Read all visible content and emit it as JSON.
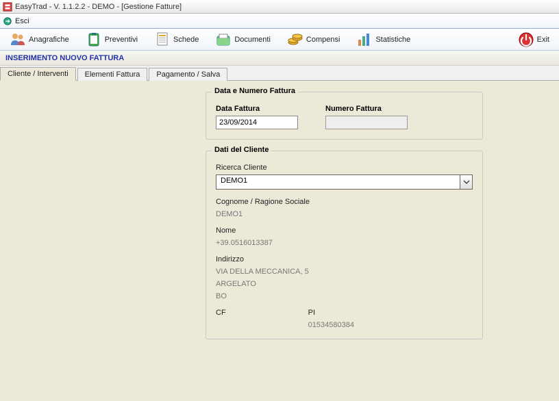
{
  "window": {
    "title": "EasyTrad - V. 1.1.2.2 - DEMO - [Gestione Fatture]"
  },
  "menu": {
    "esci": "Esci"
  },
  "toolbar": {
    "items": [
      {
        "label": "Anagrafiche"
      },
      {
        "label": "Preventivi"
      },
      {
        "label": "Schede"
      },
      {
        "label": "Documenti"
      },
      {
        "label": "Compensi"
      },
      {
        "label": "Statistiche"
      },
      {
        "label": "Exit"
      }
    ]
  },
  "section": {
    "title": "INSERIMENTO NUOVO FATTURA"
  },
  "tabs": [
    {
      "label": "Cliente / Interventi"
    },
    {
      "label": "Elementi Fattura"
    },
    {
      "label": "Pagamento / Salva"
    }
  ],
  "group1": {
    "title": "Data e Numero Fattura",
    "data_label": "Data Fattura",
    "data_value": "23/09/2014",
    "numero_label": "Numero Fattura",
    "numero_value": ""
  },
  "group2": {
    "title": "Dati del Cliente",
    "ricerca_label": "Ricerca Cliente",
    "ricerca_value": "DEMO1",
    "cognome_label": "Cognome / Ragione Sociale",
    "cognome_value": "DEMO1",
    "nome_label": "Nome",
    "nome_value": "+39.0516013387",
    "indirizzo_label": "Indirizzo",
    "indirizzo_line1": "VIA DELLA MECCANICA, 5",
    "indirizzo_line2": "ARGELATO",
    "indirizzo_line3": "BO",
    "cf_label": "CF",
    "cf_value": "",
    "pi_label": "PI",
    "pi_value": "01534580384"
  }
}
